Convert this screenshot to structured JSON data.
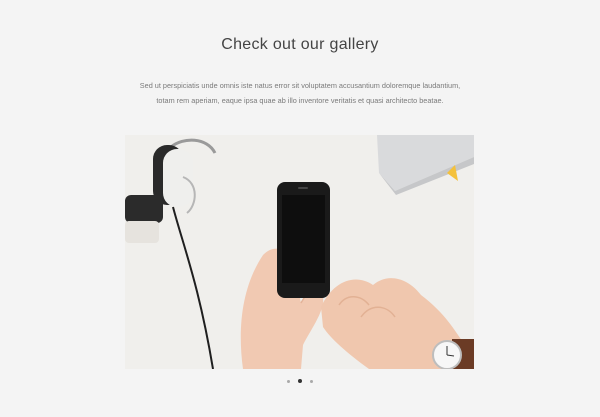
{
  "gallery": {
    "title": "Check out our gallery",
    "description_line1": "Sed ut perspiciatis unde omnis iste natus error sit voluptatem accusantium doloremque laudantium,",
    "description_line2": "totam rem aperiam, eaque ipsa quae ab illo inventore veritatis et quasi architecto beatae.",
    "slides": [
      {
        "name": "slide-1",
        "active": false
      },
      {
        "name": "slide-2",
        "active": true
      },
      {
        "name": "slide-3",
        "active": false
      }
    ]
  }
}
